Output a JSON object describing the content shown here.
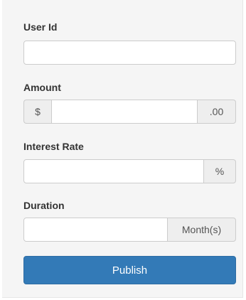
{
  "form": {
    "user_id": {
      "label": "User Id",
      "value": "",
      "placeholder": ""
    },
    "amount": {
      "label": "Amount",
      "prefix": "$",
      "suffix": ".00",
      "value": "",
      "placeholder": ""
    },
    "interest_rate": {
      "label": "Interest Rate",
      "suffix": "%",
      "value": "",
      "placeholder": ""
    },
    "duration": {
      "label": "Duration",
      "suffix": "Month(s)",
      "value": "",
      "placeholder": ""
    },
    "publish_label": "Publish"
  },
  "colors": {
    "panel_bg": "#f5f5f5",
    "primary": "#337ab7",
    "addon_bg": "#eeeeee",
    "border": "#cccccc"
  }
}
